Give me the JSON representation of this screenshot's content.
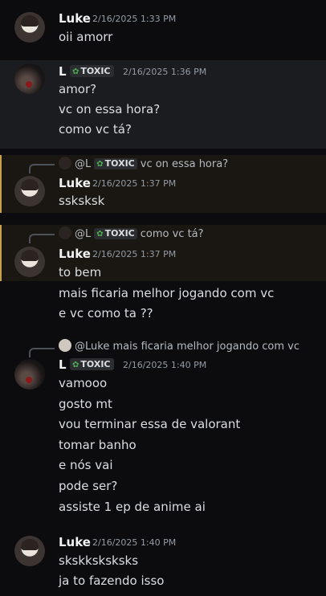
{
  "group1": {
    "author": "Luke",
    "timestamp": "2/16/2025 1:33 PM",
    "lines": [
      "oii amorr"
    ]
  },
  "group2": {
    "author": "L",
    "tag": "TOXIC",
    "timestamp": "2/16/2025 1:36 PM",
    "lines": [
      "amor?",
      "vc on essa hora?",
      "como vc tá?"
    ]
  },
  "group3": {
    "reply": {
      "author": "@L",
      "tag": "TOXIC",
      "text": "vc on essa hora?"
    },
    "author": "Luke",
    "timestamp": "2/16/2025 1:37 PM",
    "lines": [
      "ssksksk"
    ]
  },
  "group4": {
    "reply": {
      "author": "@L",
      "tag": "TOXIC",
      "text": "como vc tá?"
    },
    "author": "Luke",
    "timestamp": "2/16/2025 1:37 PM",
    "lines": [
      "to bem",
      "mais ficaria melhor jogando com vc",
      "e vc como ta ??"
    ]
  },
  "group5": {
    "reply": {
      "author": "@Luke",
      "text": "mais ficaria melhor jogando com vc"
    },
    "author": "L",
    "tag": "TOXIC",
    "timestamp": "2/16/2025 1:40 PM",
    "lines": [
      "vamooo",
      "gosto mt",
      "vou terminar essa de valorant",
      "tomar banho",
      "e nós vai",
      "pode ser?",
      "assiste 1 ep de anime ai"
    ]
  },
  "group6": {
    "author": "Luke",
    "timestamp": "2/16/2025 1:40 PM",
    "lines": [
      "skskksksksks",
      "ja to fazendo isso"
    ]
  },
  "icons": {
    "tag_leaf": "leaf-icon",
    "reply_spine": "reply-spine-icon"
  },
  "colors": {
    "background": "#0c0c0e",
    "highlight": "#1a1712",
    "highlight_bar": "#c7a14a",
    "tag_leaf": "#4caf50"
  }
}
